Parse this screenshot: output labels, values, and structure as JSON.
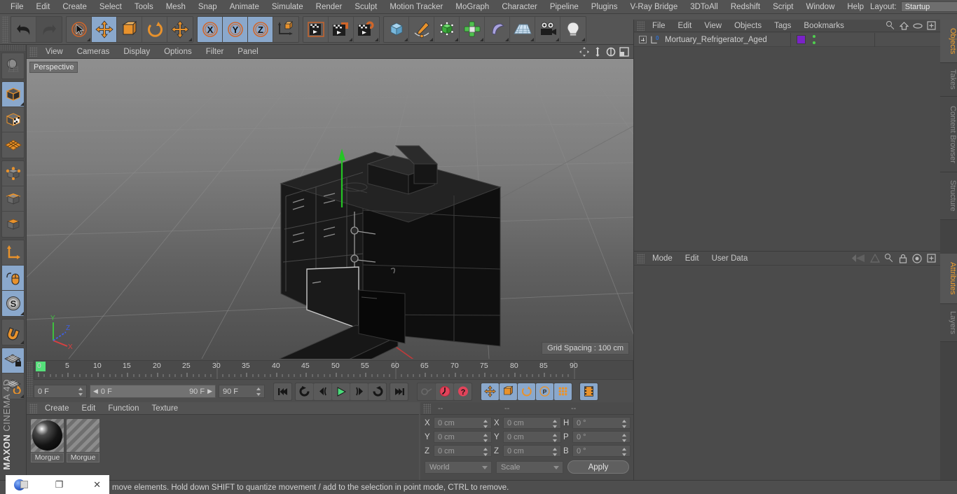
{
  "app": {
    "title": "MAXON CINEMA 4D",
    "brand_bold": "MAXON",
    "brand_light": "CINEMA 4D"
  },
  "menubar": {
    "items": [
      {
        "label": "File"
      },
      {
        "label": "Edit"
      },
      {
        "label": "Create"
      },
      {
        "label": "Select"
      },
      {
        "label": "Tools"
      },
      {
        "label": "Mesh"
      },
      {
        "label": "Snap"
      },
      {
        "label": "Animate"
      },
      {
        "label": "Simulate"
      },
      {
        "label": "Render"
      },
      {
        "label": "Sculpt"
      },
      {
        "label": "Motion Tracker"
      },
      {
        "label": "MoGraph"
      },
      {
        "label": "Character"
      },
      {
        "label": "Pipeline"
      },
      {
        "label": "Plugins"
      },
      {
        "label": "V-Ray Bridge"
      },
      {
        "label": "3DToAll"
      },
      {
        "label": "Redshift"
      },
      {
        "label": "Script"
      },
      {
        "label": "Window"
      },
      {
        "label": "Help"
      }
    ],
    "layout_label": "Layout:",
    "layout_value": "Startup",
    "search_icon": "search-icon"
  },
  "toolbar": {
    "groups": [
      {
        "name": "undo-redo",
        "buttons": [
          {
            "name": "undo-button",
            "icon": "undo-arrow-icon",
            "active": false,
            "dim": false
          },
          {
            "name": "redo-button",
            "icon": "redo-arrow-icon",
            "active": false,
            "dim": true
          }
        ]
      },
      {
        "name": "transform-tools",
        "buttons": [
          {
            "name": "live-selection-button",
            "icon": "cursor-circle-icon",
            "active": false,
            "dim": false
          },
          {
            "name": "move-tool-button",
            "icon": "move-arrows-icon",
            "active": true,
            "dim": false
          },
          {
            "name": "scale-tool-button",
            "icon": "scale-box-icon",
            "active": false,
            "dim": false
          },
          {
            "name": "rotate-tool-button",
            "icon": "rotate-circle-icon",
            "active": false,
            "dim": false
          },
          {
            "name": "global-move-button",
            "icon": "move-arrows-icon",
            "active": false,
            "dim": false
          }
        ]
      },
      {
        "name": "axis-locks",
        "buttons": [
          {
            "name": "lock-x-button",
            "icon": "x-axis-icon",
            "active": true,
            "dim": false
          },
          {
            "name": "lock-y-button",
            "icon": "y-axis-icon",
            "active": true,
            "dim": false
          },
          {
            "name": "lock-z-button",
            "icon": "z-axis-icon",
            "active": true,
            "dim": false
          },
          {
            "name": "world-coordinates-button",
            "icon": "world-axis-cube-icon",
            "active": false,
            "dim": false
          }
        ]
      },
      {
        "name": "render-tools",
        "buttons": [
          {
            "name": "render-view-button",
            "icon": "clapper-view-icon",
            "active": false,
            "dim": false
          },
          {
            "name": "render-region-button",
            "icon": "clapper-region-icon",
            "active": false,
            "dim": false
          },
          {
            "name": "render-settings-button",
            "icon": "clapper-gear-icon",
            "active": false,
            "dim": false
          }
        ]
      },
      {
        "name": "create-objects",
        "buttons": [
          {
            "name": "add-cube-button",
            "icon": "cube-icon",
            "active": false,
            "dim": false
          },
          {
            "name": "add-spline-button",
            "icon": "pen-spline-icon",
            "active": false,
            "dim": false
          },
          {
            "name": "add-generator-button",
            "icon": "green-cube-icon",
            "active": false,
            "dim": false
          },
          {
            "name": "add-array-button",
            "icon": "green-cluster-icon",
            "active": false,
            "dim": false
          },
          {
            "name": "add-deformer-button",
            "icon": "bend-deformer-icon",
            "active": false,
            "dim": false
          },
          {
            "name": "add-scene-button",
            "icon": "floor-grid-icon",
            "active": false,
            "dim": false
          },
          {
            "name": "add-camera-button",
            "icon": "camera-icon",
            "active": false,
            "dim": false
          },
          {
            "name": "add-light-button",
            "icon": "light-bulb-icon",
            "active": false,
            "dim": false
          }
        ]
      }
    ]
  },
  "left_toolbar": {
    "groups": [
      {
        "buttons": [
          {
            "name": "make-editable-button",
            "icon": "globe-wire-icon",
            "active": false
          }
        ]
      },
      {
        "buttons": [
          {
            "name": "model-mode-button",
            "icon": "model-cube-icon",
            "active": true
          },
          {
            "name": "texture-mode-button",
            "icon": "texture-cube-icon",
            "active": false
          },
          {
            "name": "workplane-mode-button",
            "icon": "workplane-grid-icon",
            "active": false
          }
        ]
      },
      {
        "buttons": [
          {
            "name": "points-mode-button",
            "icon": "points-cube-icon",
            "active": false
          },
          {
            "name": "edges-mode-button",
            "icon": "edges-cube-icon",
            "active": false
          },
          {
            "name": "polygons-mode-button",
            "icon": "polygons-cube-icon",
            "active": false
          }
        ]
      },
      {
        "buttons": [
          {
            "name": "object-axis-button",
            "icon": "axis-arrow-icon",
            "active": false
          },
          {
            "name": "enable-axis-button",
            "icon": "mouse-axis-icon",
            "active": true
          },
          {
            "name": "soft-selection-button",
            "icon": "s-sphere-icon",
            "active": true
          }
        ]
      },
      {
        "buttons": [
          {
            "name": "snap-magnet-button",
            "icon": "magnet-icon",
            "active": false
          }
        ]
      },
      {
        "buttons": [
          {
            "name": "workplane-lock-button",
            "icon": "grid-lock-icon",
            "active": true
          },
          {
            "name": "workplane-reset-button",
            "icon": "grid-rotate-icon",
            "active": false
          }
        ]
      }
    ]
  },
  "viewport": {
    "menu": [
      {
        "label": "View"
      },
      {
        "label": "Cameras"
      },
      {
        "label": "Display"
      },
      {
        "label": "Options"
      },
      {
        "label": "Filter"
      },
      {
        "label": "Panel"
      }
    ],
    "icons": [
      "pan-icon",
      "dolly-icon",
      "orbit-icon",
      "maximize-icon"
    ],
    "view_label": "Perspective",
    "grid_spacing": "Grid Spacing : 100 cm",
    "axis_gizmo": {
      "x": "X",
      "y": "Y",
      "z": "Z",
      "x_color": "#d84040",
      "y_color": "#3fbf3f",
      "z_color": "#4060e0"
    },
    "scene_object": "Mortuary_Refrigerator_Aged"
  },
  "timeline": {
    "ticks": [
      "0",
      "5",
      "10",
      "15",
      "20",
      "25",
      "30",
      "35",
      "40",
      "45",
      "50",
      "55",
      "60",
      "65",
      "70",
      "75",
      "80",
      "85",
      "90"
    ],
    "current_frame_field": "0 F",
    "current_frame_field_right": "0 F",
    "range_start": "0 F",
    "range_end": "90 F",
    "end_frame_field": "90 F",
    "playhead_frame": 0,
    "transport": [
      {
        "name": "go-to-start-button",
        "icon": "skip-start-icon",
        "active": false
      },
      {
        "name": "loop-button",
        "icon": "loop-back-icon",
        "active": false
      },
      {
        "name": "step-back-button",
        "icon": "step-back-icon",
        "active": false
      },
      {
        "name": "play-button",
        "icon": "play-icon",
        "active": false
      },
      {
        "name": "step-forward-button",
        "icon": "step-forward-icon",
        "active": false
      },
      {
        "name": "loop-forward-button",
        "icon": "loop-forward-icon",
        "active": false
      },
      {
        "name": "go-to-end-button",
        "icon": "skip-end-icon",
        "active": false
      }
    ],
    "keyframe_tools": [
      {
        "name": "autokey-button",
        "icon": "key-icon",
        "active": false
      },
      {
        "name": "record-keyframe-button",
        "icon": "record-red-icon",
        "active": false
      },
      {
        "name": "keyframe-selection-button",
        "icon": "question-red-icon",
        "active": false
      }
    ],
    "record_toggles": [
      {
        "name": "record-position-button",
        "icon": "move-arrows-icon",
        "active": true
      },
      {
        "name": "record-scale-button",
        "icon": "scale-box-icon",
        "active": true
      },
      {
        "name": "record-rotation-button",
        "icon": "rotate-circle-icon",
        "active": true
      },
      {
        "name": "record-parameter-button",
        "icon": "p-circle-icon",
        "active": true
      },
      {
        "name": "record-pla-button",
        "icon": "point-level-icon",
        "active": true
      },
      {
        "name": "timeline-view-button",
        "icon": "filmstrip-icon",
        "active": true
      }
    ]
  },
  "materials": {
    "menu": [
      {
        "label": "Create"
      },
      {
        "label": "Edit"
      },
      {
        "label": "Function"
      },
      {
        "label": "Texture"
      }
    ],
    "items": [
      {
        "name": "Morgue",
        "selected": true
      },
      {
        "name": "Morgue",
        "selected": false
      }
    ]
  },
  "coordinates": {
    "header": [
      "--",
      "--",
      "--"
    ],
    "position": {
      "label_x": "X",
      "label_y": "Y",
      "label_z": "Z",
      "x": "0 cm",
      "y": "0 cm",
      "z": "0 cm"
    },
    "size": {
      "label_x": "X",
      "label_y": "Y",
      "label_z": "Z",
      "x": "0 cm",
      "y": "0 cm",
      "z": "0 cm"
    },
    "rotation": {
      "label_h": "H",
      "label_p": "P",
      "label_b": "B",
      "h": "0 °",
      "p": "0 °",
      "b": "0 °"
    },
    "system": "World",
    "mode": "Scale",
    "apply_label": "Apply"
  },
  "object_manager": {
    "menu": [
      {
        "label": "File"
      },
      {
        "label": "Edit"
      },
      {
        "label": "View"
      },
      {
        "label": "Objects"
      },
      {
        "label": "Tags"
      },
      {
        "label": "Bookmarks"
      }
    ],
    "icons": [
      "search-icon",
      "home-icon",
      "ellipse-icon",
      "plus-box-icon"
    ],
    "rows": [
      {
        "name": "Mortuary_Refrigerator_Aged",
        "layer_badge": "0",
        "tag_color": "#7a22c8",
        "has_children": true
      }
    ]
  },
  "attribute_manager": {
    "menu": [
      {
        "label": "Mode"
      },
      {
        "label": "Edit"
      },
      {
        "label": "User Data"
      }
    ],
    "icons": [
      "history-back-icon",
      "history-forward-icon",
      "search-icon",
      "lock-icon",
      "target-icon",
      "plus-box-icon"
    ]
  },
  "right_tabs": {
    "top": [
      {
        "label": "Objects",
        "selected": true
      },
      {
        "label": "Takes",
        "selected": false
      },
      {
        "label": "Content Browser",
        "selected": false
      },
      {
        "label": "Structure",
        "selected": false
      }
    ],
    "bottom": [
      {
        "label": "Attributes",
        "selected": true
      },
      {
        "label": "Layers",
        "selected": false
      }
    ]
  },
  "statusbar": {
    "message": "move elements. Hold down SHIFT to quantize movement / add to the selection in point mode, CTRL to remove."
  },
  "taskbar": {
    "app_icon": "chrome-icon",
    "restore_label": "❐",
    "close_label": "✕"
  },
  "colors": {
    "accent_orange": "#f0a030",
    "active_blue": "#8aa8cc",
    "panel_bg": "#4b4b4b",
    "toolbar_bg": "#555555",
    "tag_purple": "#7a22c8"
  }
}
